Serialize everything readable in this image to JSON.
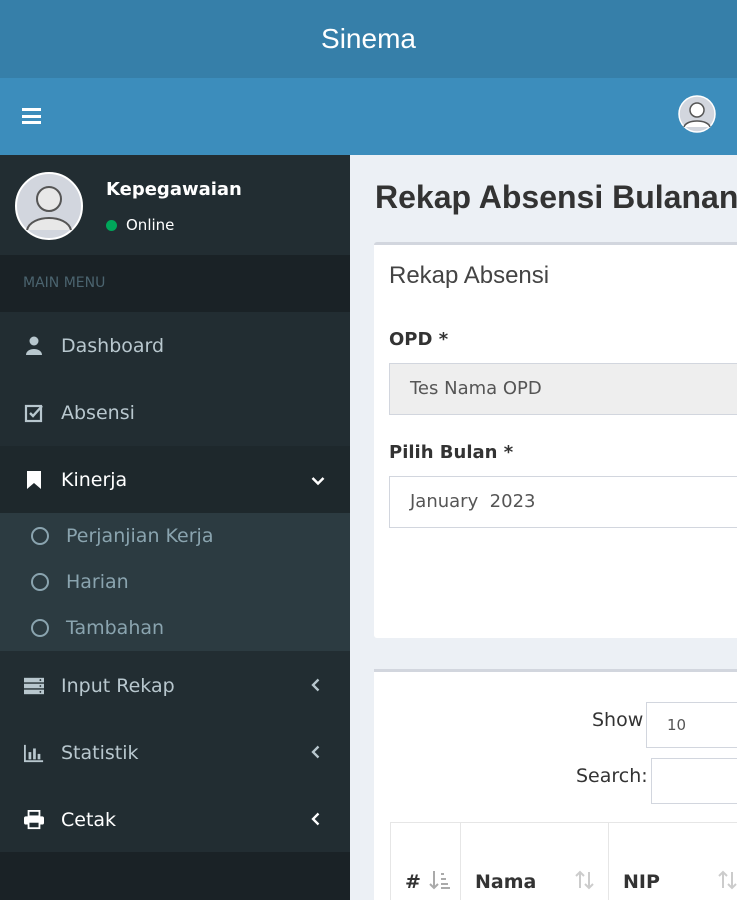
{
  "app": {
    "title": "Sinema"
  },
  "user": {
    "name": "Kepegawaian",
    "status": "Online"
  },
  "sidebar": {
    "header": "MAIN MENU",
    "items": [
      {
        "label": "Dashboard",
        "icon": "user-icon"
      },
      {
        "label": "Absensi",
        "icon": "check-square-icon"
      },
      {
        "label": "Kinerja",
        "icon": "bookmark-icon",
        "expanded": true
      },
      {
        "label": "Input Rekap",
        "icon": "server-icon"
      },
      {
        "label": "Statistik",
        "icon": "bar-chart-icon"
      },
      {
        "label": "Cetak",
        "icon": "print-icon"
      }
    ],
    "submenu": [
      {
        "label": "Perjanjian Kerja"
      },
      {
        "label": "Harian"
      },
      {
        "label": "Tambahan"
      }
    ]
  },
  "page": {
    "title": "Rekap Absensi Bulanan"
  },
  "form": {
    "box_title": "Rekap Absensi",
    "opd_label": "OPD *",
    "opd_value": "Tes Nama OPD",
    "month_label": "Pilih Bulan *",
    "month_value": "January  2023"
  },
  "table": {
    "show_label": "Show",
    "page_size": "10",
    "search_label": "Search:",
    "columns": [
      "#",
      "Nama",
      "NIP"
    ]
  },
  "colors": {
    "topbar": "#367fa9",
    "navbar": "#3c8dbc",
    "sidebar": "#222d32",
    "online": "#00a65a"
  }
}
